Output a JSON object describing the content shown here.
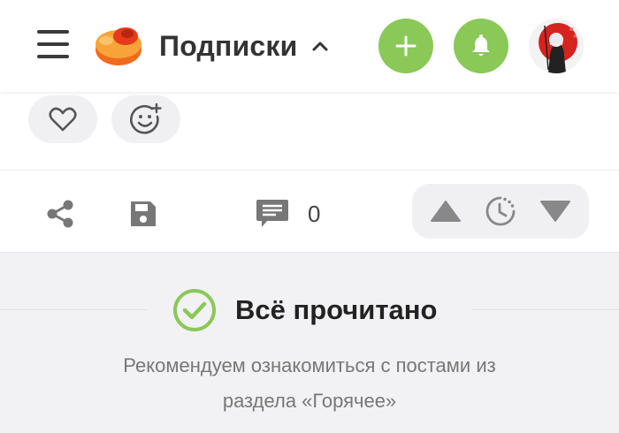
{
  "header": {
    "feed_title": "Подписки",
    "logo_icon": "pikabu-logo-icon",
    "accent_color": "#8ac858"
  },
  "post": {
    "comments_count": "0"
  },
  "feed_end": {
    "title": "Всё прочитано",
    "recommend_text": "Рекомендуем ознакомиться с постами из",
    "recommend_link": "раздела «Горячее»"
  }
}
